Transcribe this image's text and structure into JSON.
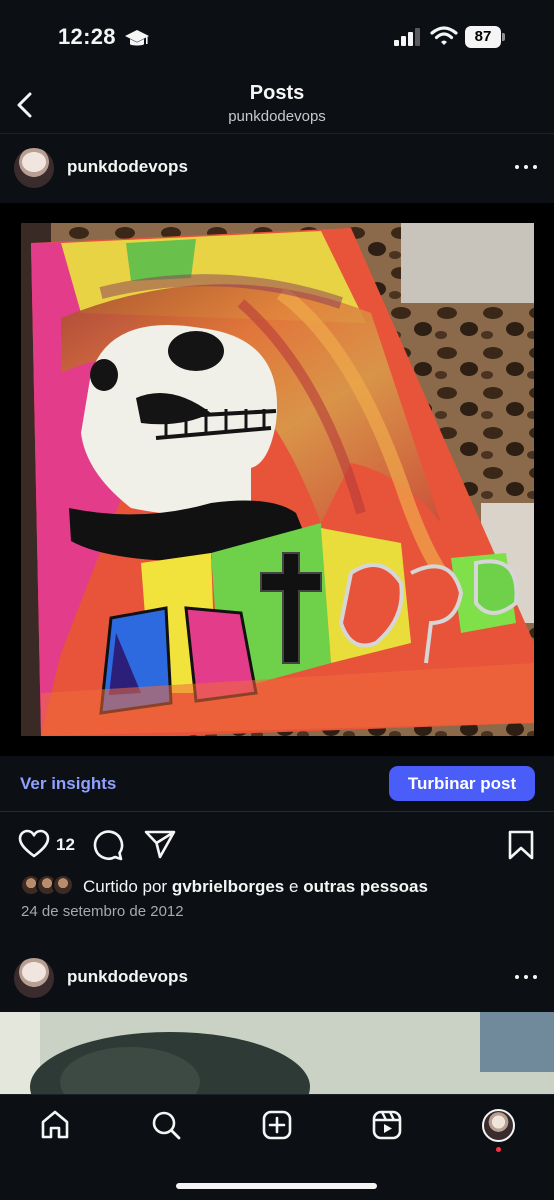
{
  "status_bar": {
    "time": "12:28",
    "battery": "87"
  },
  "header": {
    "title": "Posts",
    "subtitle": "punkdodevops"
  },
  "post": {
    "username": "punkdodevops",
    "insights_label": "Ver insights",
    "boost_label": "Turbinar post",
    "like_count": "12",
    "liked_prefix": "Curtido por",
    "liked_user": "gvbrielborges",
    "liked_joiner": "e",
    "liked_others": "outras pessoas",
    "date": "24 de setembro de 2012"
  },
  "post2": {
    "username": "punkdodevops"
  },
  "colors": {
    "background": "#0c1014",
    "accent": "#4a5df9",
    "link": "#8ea1ff",
    "notification": "#ff3040"
  },
  "bottom_nav": [
    "home-icon",
    "search-icon",
    "create-icon",
    "reels-icon",
    "profile-avatar"
  ]
}
